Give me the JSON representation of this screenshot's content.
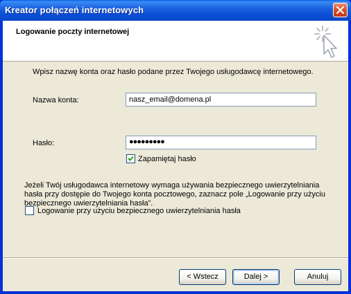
{
  "window": {
    "title": "Kreator połączeń internetowych"
  },
  "header": {
    "title": "Logowanie poczty internetowej",
    "icon": "wizard-cursor-icon"
  },
  "form": {
    "intro": "Wpisz nazwę konta oraz hasło podane przez Twojego usługodawcę internetowego.",
    "account_label": "Nazwa konta:",
    "account_value": "nasz_email@domena.pl",
    "password_label": "Hasło:",
    "password_value": "●●●●●●●●●",
    "remember_label": "Zapamiętaj hasło",
    "remember_checked": true,
    "spa_info": "Jeżeli Twój usługodawca internetowy wymaga używania bezpiecznego uwierzytelniania hasła przy dostępie do Twojego konta pocztowego, zaznacz pole „Logowanie przy użyciu bezpiecznego uwierzytelniania hasła”.",
    "spa_label": "Logowanie przy użyciu bezpiecznego uwierzytelniania hasła",
    "spa_checked": false
  },
  "buttons": {
    "back": "< Wstecz",
    "next": "Dalej >",
    "cancel": "Anuluj"
  },
  "colors": {
    "titlebar": "#0a4fd6",
    "dialog_bg": "#ece9d8",
    "textbox_border": "#7f9db9",
    "check_mark": "#21a121"
  }
}
